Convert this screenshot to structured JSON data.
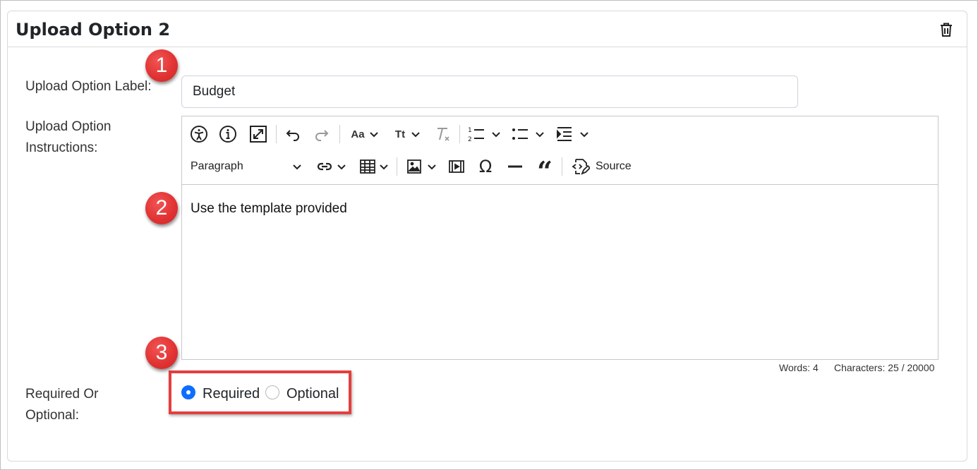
{
  "card": {
    "title": "Upload Option 2"
  },
  "form": {
    "label_field": {
      "label": "Upload Option Label:",
      "value": "Budget"
    },
    "instructions": {
      "label_line1": "Upload Option",
      "label_line2": "Instructions:",
      "content": "Use the template provided",
      "paragraph_select": "Paragraph",
      "source_label": "Source",
      "words": "Words: 4",
      "characters": "Characters: 25 / 20000"
    },
    "required": {
      "label_line1": "Required Or",
      "label_line2": "Optional:",
      "options": [
        {
          "label": "Required",
          "checked": true
        },
        {
          "label": "Optional",
          "checked": false
        }
      ]
    }
  },
  "annotations": [
    "1",
    "2",
    "3"
  ],
  "colors": {
    "badge": "#e03131",
    "radio_accent": "#0d6efd",
    "highlight": "#e53e3e"
  }
}
